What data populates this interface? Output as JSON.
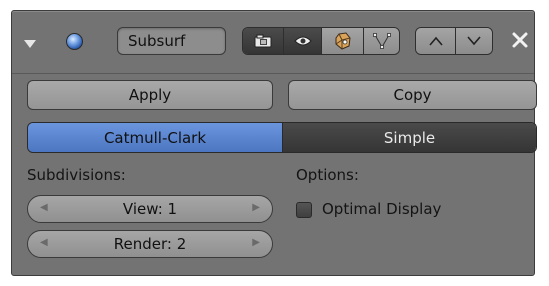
{
  "modifier": {
    "name": "Subsurf",
    "expand_icon": "triangle-down-icon",
    "type_icon": "subsurf-sphere-icon",
    "visibility_buttons": [
      "camera-icon",
      "eye-icon",
      "editmode-icon",
      "cage-icon"
    ],
    "move_buttons": [
      "move-up-icon",
      "move-down-icon"
    ],
    "close_icon": "close-x-icon"
  },
  "actions": {
    "apply": "Apply",
    "copy": "Copy"
  },
  "algorithm": {
    "options": [
      "Catmull-Clark",
      "Simple"
    ],
    "selected": "Catmull-Clark"
  },
  "subdivisions": {
    "label": "Subdivisions:",
    "view": "View: 1",
    "render": "Render: 2"
  },
  "options": {
    "label": "Options:",
    "optimal_display": "Optimal Display",
    "optimal_display_checked": false
  },
  "colors": {
    "panel_bg": "#737373",
    "selected_tab": "#5b86d1",
    "dark_widget": "#3d3d3d"
  }
}
